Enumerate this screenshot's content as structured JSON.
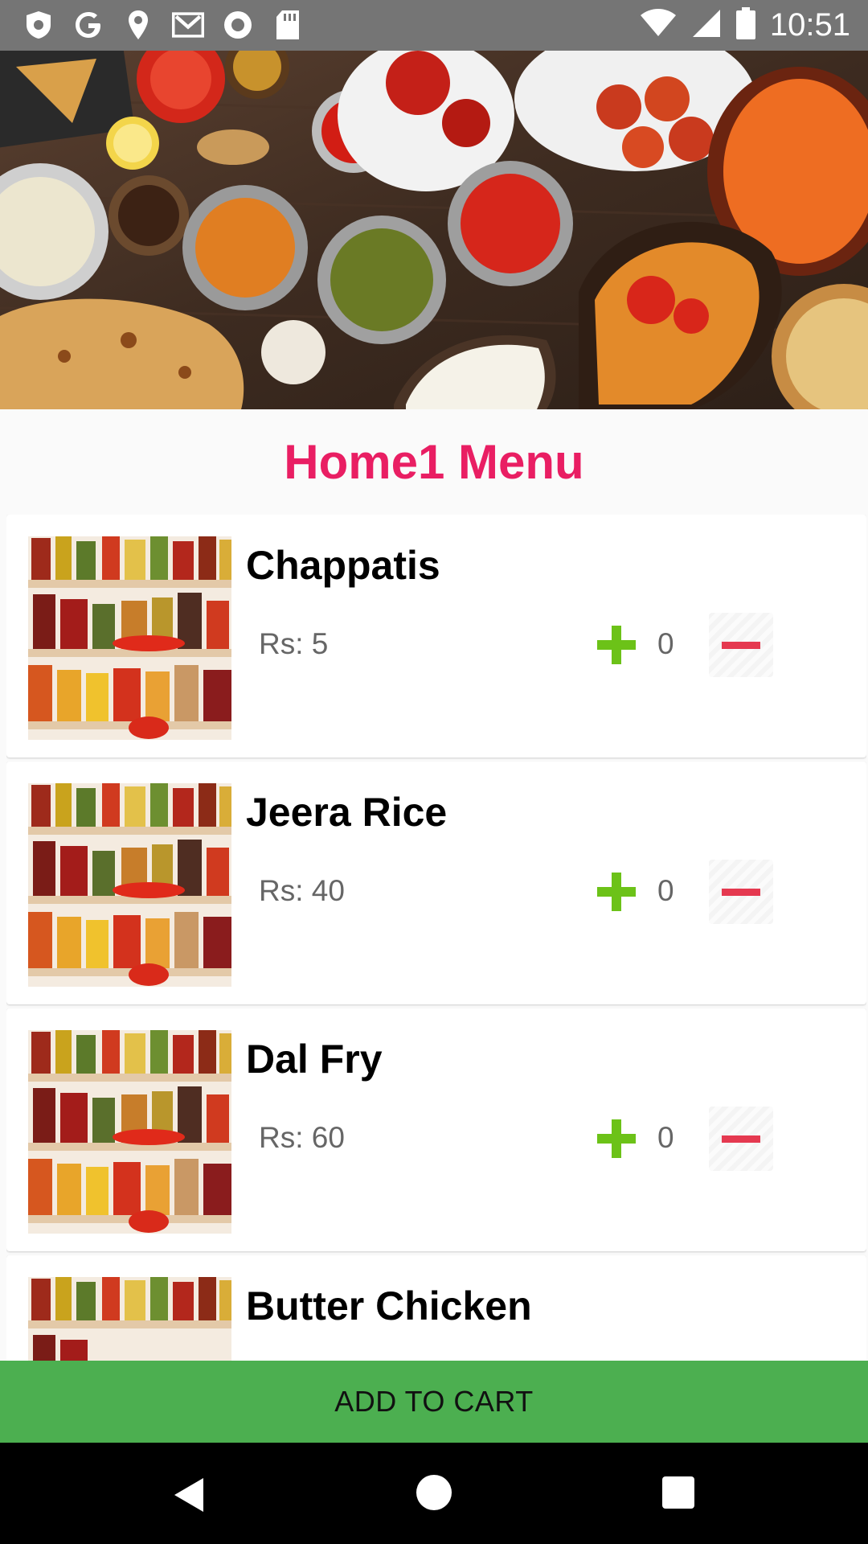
{
  "status_bar": {
    "time": "10:51",
    "left_icons": [
      "shield-icon",
      "google-g-icon",
      "location-pin-icon",
      "gmail-icon",
      "radio-icon",
      "sd-card-icon"
    ],
    "right_icons": [
      "wifi-icon",
      "signal-icon",
      "battery-icon"
    ],
    "background": "#757575"
  },
  "header": {
    "title": "Home1 Menu",
    "title_color": "#e91e63"
  },
  "menu": {
    "items": [
      {
        "name": "Chappatis",
        "price": "Rs: 5",
        "quantity": "0"
      },
      {
        "name": "Jeera Rice",
        "price": "Rs: 40",
        "quantity": "0"
      },
      {
        "name": "Dal Fry",
        "price": "Rs: 60",
        "quantity": "0"
      },
      {
        "name": "Butter Chicken",
        "price": "",
        "quantity": ""
      }
    ]
  },
  "cart": {
    "label": "ADD TO CART",
    "background": "#4caf50"
  },
  "colors": {
    "plus": "#6cc218",
    "minus": "#e53950"
  },
  "nav_bar": {
    "icons": [
      "back-icon",
      "home-icon",
      "recents-icon"
    ]
  }
}
